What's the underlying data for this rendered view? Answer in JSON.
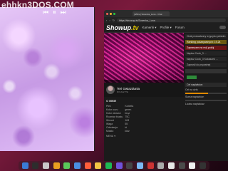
{
  "watermark": "ehhkn3DOS.COM",
  "video_controls": [
    "⏮",
    "⏸",
    "⏭"
  ],
  "browser": {
    "tab_title": "[offline] Sosenka_Luna - Chat",
    "url": "https://showup.tv/Sosenka_Luna",
    "nav_buttons": [
      "‹",
      "›",
      "↻"
    ]
  },
  "site": {
    "logo_main": "Showup",
    "logo_tld": ".tv",
    "nav": [
      "Kamerki ▾",
      "Profile ▾",
      "Forum"
    ]
  },
  "profile": {
    "name": "Teri Gwiazdunia",
    "subtitle": "ROULETTE"
  },
  "about": {
    "heading": "O MNIE",
    "rows": [
      [
        "Płeć",
        "Kobieta"
      ],
      [
        "Kolor oczu",
        "green"
      ],
      [
        "Kolor włosów",
        "brąz"
      ],
      [
        "Rozmiar biustu",
        "75C"
      ],
      [
        "Wzrost",
        "163"
      ],
      [
        "Waga",
        "55"
      ],
      [
        "Orientacja",
        "bi"
      ],
      [
        "Miasto",
        "łódź"
      ]
    ],
    "footer": "MENU ▾"
  },
  "chat": {
    "messages": [
      {
        "text": "Chat prowadzony w języku polskim",
        "style": "n"
      },
      {
        "text": "Ranking pokazywanych: 19.24",
        "style": "y"
      },
      {
        "text": "Zapraszam na mój pokój",
        "style": "r"
      },
      {
        "text": "Napisz Cook_3 ...",
        "style": "n"
      },
      {
        "text": "Napisz Cook_3 Kukaszek ...",
        "style": "n"
      },
      {
        "text": "Zaprosił do prywatnej",
        "style": "n"
      }
    ],
    "tip_button": "Tip"
  },
  "tips": {
    "header": "Cel napiwków:",
    "goal_label": "Cel na dziś:",
    "goal_progress": 0.55,
    "sum_label": "Suma napiwków:",
    "last_label": "Liczba napiwków:"
  },
  "dock_colors": [
    "#3a7bd5",
    "#2d2d2d",
    "#c8c8c8",
    "#e8a020",
    "#5ac85a",
    "#4a90e2",
    "#ff5e3a",
    "#f2c744",
    "#1db954",
    "#6f52d9",
    "#444444",
    "#7ab8f5",
    "#cc3333",
    "#aaaaaa",
    "#e8e8e8",
    "#4a4a4a",
    "#f0f0f0",
    "#333333"
  ]
}
